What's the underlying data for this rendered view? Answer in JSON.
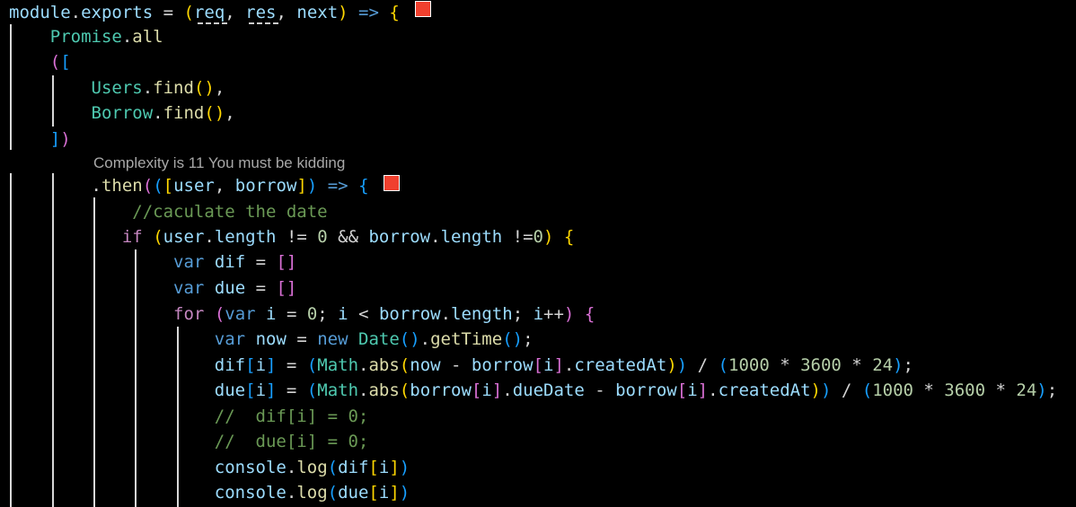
{
  "colors": {
    "background": "#000000",
    "keyword": "#c586c0",
    "function": "#dcdcaa",
    "variable": "#9cdcfe",
    "property": "#9cdcfe",
    "type": "#4ec9b0",
    "number": "#b5cea8",
    "comment": "#6a9955",
    "punctuation": "#d4d4d4",
    "bracket_gold": "#ffd700",
    "bracket_purple": "#da70d6",
    "bracket_blue": "#179fff",
    "codelens": "#a8a8a8",
    "indent_guide": "#d8d8d8",
    "marker": "#f0402e"
  },
  "codelens": "Complexity is 11 You must be kidding",
  "lines": [
    [
      {
        "t": "module",
        "c": "#9cdcfe"
      },
      {
        "t": ".",
        "c": "#d4d4d4"
      },
      {
        "t": "exports",
        "c": "#9cdcfe"
      },
      {
        "t": " = ",
        "c": "#d4d4d4"
      },
      {
        "t": "(",
        "c": "#ffd700"
      },
      {
        "t": "req",
        "c": "#9cdcfe"
      },
      {
        "t": ", ",
        "c": "#d4d4d4"
      },
      {
        "t": "res",
        "c": "#9cdcfe"
      },
      {
        "t": ", ",
        "c": "#d4d4d4"
      },
      {
        "t": "next",
        "c": "#9cdcfe"
      },
      {
        "t": ")",
        "c": "#ffd700"
      },
      {
        "t": " => ",
        "c": "#569cd6"
      },
      {
        "t": "{",
        "c": "#ffd700"
      }
    ],
    [
      {
        "t": "    ",
        "c": "#d4d4d4"
      },
      {
        "t": "Promise",
        "c": "#4ec9b0"
      },
      {
        "t": ".",
        "c": "#d4d4d4"
      },
      {
        "t": "all",
        "c": "#dcdcaa"
      }
    ],
    [
      {
        "t": "    ",
        "c": "#d4d4d4"
      },
      {
        "t": "(",
        "c": "#da70d6"
      },
      {
        "t": "[",
        "c": "#179fff"
      }
    ],
    [
      {
        "t": "        ",
        "c": "#d4d4d4"
      },
      {
        "t": "Users",
        "c": "#4ec9b0"
      },
      {
        "t": ".",
        "c": "#d4d4d4"
      },
      {
        "t": "find",
        "c": "#dcdcaa"
      },
      {
        "t": "()",
        "c": "#ffd700"
      },
      {
        "t": ",",
        "c": "#d4d4d4"
      }
    ],
    [
      {
        "t": "        ",
        "c": "#d4d4d4"
      },
      {
        "t": "Borrow",
        "c": "#4ec9b0"
      },
      {
        "t": ".",
        "c": "#d4d4d4"
      },
      {
        "t": "find",
        "c": "#dcdcaa"
      },
      {
        "t": "()",
        "c": "#ffd700"
      },
      {
        "t": ",",
        "c": "#d4d4d4"
      }
    ],
    [
      {
        "t": "    ",
        "c": "#d4d4d4"
      },
      {
        "t": "]",
        "c": "#179fff"
      },
      {
        "t": ")",
        "c": "#da70d6"
      }
    ],
    [
      {
        "t": "        ",
        "c": "#d4d4d4"
      },
      {
        "t": ".",
        "c": "#d4d4d4"
      },
      {
        "t": "then",
        "c": "#dcdcaa"
      },
      {
        "t": "(",
        "c": "#da70d6"
      },
      {
        "t": "(",
        "c": "#179fff"
      },
      {
        "t": "[",
        "c": "#ffd700"
      },
      {
        "t": "user",
        "c": "#9cdcfe"
      },
      {
        "t": ", ",
        "c": "#d4d4d4"
      },
      {
        "t": "borrow",
        "c": "#9cdcfe"
      },
      {
        "t": "]",
        "c": "#ffd700"
      },
      {
        "t": ")",
        "c": "#179fff"
      },
      {
        "t": " => ",
        "c": "#569cd6"
      },
      {
        "t": "{",
        "c": "#179fff"
      }
    ],
    [
      {
        "t": "            ",
        "c": "#d4d4d4"
      },
      {
        "t": "//caculate the date",
        "c": "#6a9955"
      }
    ],
    [
      {
        "t": "           ",
        "c": "#d4d4d4"
      },
      {
        "t": "if",
        "c": "#c586c0"
      },
      {
        "t": " ",
        "c": "#d4d4d4"
      },
      {
        "t": "(",
        "c": "#ffd700"
      },
      {
        "t": "user",
        "c": "#9cdcfe"
      },
      {
        "t": ".",
        "c": "#d4d4d4"
      },
      {
        "t": "length",
        "c": "#9cdcfe"
      },
      {
        "t": " != ",
        "c": "#d4d4d4"
      },
      {
        "t": "0",
        "c": "#b5cea8"
      },
      {
        "t": " && ",
        "c": "#d4d4d4"
      },
      {
        "t": "borrow",
        "c": "#9cdcfe"
      },
      {
        "t": ".",
        "c": "#d4d4d4"
      },
      {
        "t": "length",
        "c": "#9cdcfe"
      },
      {
        "t": " !=",
        "c": "#d4d4d4"
      },
      {
        "t": "0",
        "c": "#b5cea8"
      },
      {
        "t": ")",
        "c": "#ffd700"
      },
      {
        "t": " ",
        "c": "#d4d4d4"
      },
      {
        "t": "{",
        "c": "#ffd700"
      }
    ],
    [
      {
        "t": "                ",
        "c": "#d4d4d4"
      },
      {
        "t": "var",
        "c": "#569cd6"
      },
      {
        "t": " ",
        "c": "#d4d4d4"
      },
      {
        "t": "dif",
        "c": "#9cdcfe"
      },
      {
        "t": " = ",
        "c": "#d4d4d4"
      },
      {
        "t": "[]",
        "c": "#da70d6"
      }
    ],
    [
      {
        "t": "                ",
        "c": "#d4d4d4"
      },
      {
        "t": "var",
        "c": "#569cd6"
      },
      {
        "t": " ",
        "c": "#d4d4d4"
      },
      {
        "t": "due",
        "c": "#9cdcfe"
      },
      {
        "t": " = ",
        "c": "#d4d4d4"
      },
      {
        "t": "[]",
        "c": "#da70d6"
      }
    ],
    [
      {
        "t": "                ",
        "c": "#d4d4d4"
      },
      {
        "t": "for",
        "c": "#c586c0"
      },
      {
        "t": " ",
        "c": "#d4d4d4"
      },
      {
        "t": "(",
        "c": "#da70d6"
      },
      {
        "t": "var",
        "c": "#569cd6"
      },
      {
        "t": " ",
        "c": "#d4d4d4"
      },
      {
        "t": "i",
        "c": "#9cdcfe"
      },
      {
        "t": " = ",
        "c": "#d4d4d4"
      },
      {
        "t": "0",
        "c": "#b5cea8"
      },
      {
        "t": "; ",
        "c": "#d4d4d4"
      },
      {
        "t": "i",
        "c": "#9cdcfe"
      },
      {
        "t": " < ",
        "c": "#d4d4d4"
      },
      {
        "t": "borrow",
        "c": "#9cdcfe"
      },
      {
        "t": ".",
        "c": "#d4d4d4"
      },
      {
        "t": "length",
        "c": "#9cdcfe"
      },
      {
        "t": "; ",
        "c": "#d4d4d4"
      },
      {
        "t": "i",
        "c": "#9cdcfe"
      },
      {
        "t": "++",
        "c": "#d4d4d4"
      },
      {
        "t": ")",
        "c": "#da70d6"
      },
      {
        "t": " ",
        "c": "#d4d4d4"
      },
      {
        "t": "{",
        "c": "#da70d6"
      }
    ],
    [
      {
        "t": "                    ",
        "c": "#d4d4d4"
      },
      {
        "t": "var",
        "c": "#569cd6"
      },
      {
        "t": " ",
        "c": "#d4d4d4"
      },
      {
        "t": "now",
        "c": "#9cdcfe"
      },
      {
        "t": " = ",
        "c": "#d4d4d4"
      },
      {
        "t": "new",
        "c": "#569cd6"
      },
      {
        "t": " ",
        "c": "#d4d4d4"
      },
      {
        "t": "Date",
        "c": "#4ec9b0"
      },
      {
        "t": "()",
        "c": "#179fff"
      },
      {
        "t": ".",
        "c": "#d4d4d4"
      },
      {
        "t": "getTime",
        "c": "#dcdcaa"
      },
      {
        "t": "()",
        "c": "#179fff"
      },
      {
        "t": ";",
        "c": "#d4d4d4"
      }
    ],
    [
      {
        "t": "                    ",
        "c": "#d4d4d4"
      },
      {
        "t": "dif",
        "c": "#9cdcfe"
      },
      {
        "t": "[",
        "c": "#179fff"
      },
      {
        "t": "i",
        "c": "#9cdcfe"
      },
      {
        "t": "]",
        "c": "#179fff"
      },
      {
        "t": " = ",
        "c": "#d4d4d4"
      },
      {
        "t": "(",
        "c": "#179fff"
      },
      {
        "t": "Math",
        "c": "#4ec9b0"
      },
      {
        "t": ".",
        "c": "#d4d4d4"
      },
      {
        "t": "abs",
        "c": "#dcdcaa"
      },
      {
        "t": "(",
        "c": "#ffd700"
      },
      {
        "t": "now",
        "c": "#9cdcfe"
      },
      {
        "t": " - ",
        "c": "#d4d4d4"
      },
      {
        "t": "borrow",
        "c": "#9cdcfe"
      },
      {
        "t": "[",
        "c": "#da70d6"
      },
      {
        "t": "i",
        "c": "#9cdcfe"
      },
      {
        "t": "]",
        "c": "#da70d6"
      },
      {
        "t": ".",
        "c": "#d4d4d4"
      },
      {
        "t": "createdAt",
        "c": "#9cdcfe"
      },
      {
        "t": ")",
        "c": "#ffd700"
      },
      {
        "t": ")",
        "c": "#179fff"
      },
      {
        "t": " / ",
        "c": "#d4d4d4"
      },
      {
        "t": "(",
        "c": "#179fff"
      },
      {
        "t": "1000",
        "c": "#b5cea8"
      },
      {
        "t": " * ",
        "c": "#d4d4d4"
      },
      {
        "t": "3600",
        "c": "#b5cea8"
      },
      {
        "t": " * ",
        "c": "#d4d4d4"
      },
      {
        "t": "24",
        "c": "#b5cea8"
      },
      {
        "t": ")",
        "c": "#179fff"
      },
      {
        "t": ";",
        "c": "#d4d4d4"
      }
    ],
    [
      {
        "t": "                    ",
        "c": "#d4d4d4"
      },
      {
        "t": "due",
        "c": "#9cdcfe"
      },
      {
        "t": "[",
        "c": "#179fff"
      },
      {
        "t": "i",
        "c": "#9cdcfe"
      },
      {
        "t": "]",
        "c": "#179fff"
      },
      {
        "t": " = ",
        "c": "#d4d4d4"
      },
      {
        "t": "(",
        "c": "#179fff"
      },
      {
        "t": "Math",
        "c": "#4ec9b0"
      },
      {
        "t": ".",
        "c": "#d4d4d4"
      },
      {
        "t": "abs",
        "c": "#dcdcaa"
      },
      {
        "t": "(",
        "c": "#ffd700"
      },
      {
        "t": "borrow",
        "c": "#9cdcfe"
      },
      {
        "t": "[",
        "c": "#da70d6"
      },
      {
        "t": "i",
        "c": "#9cdcfe"
      },
      {
        "t": "]",
        "c": "#da70d6"
      },
      {
        "t": ".",
        "c": "#d4d4d4"
      },
      {
        "t": "dueDate",
        "c": "#9cdcfe"
      },
      {
        "t": " - ",
        "c": "#d4d4d4"
      },
      {
        "t": "borrow",
        "c": "#9cdcfe"
      },
      {
        "t": "[",
        "c": "#da70d6"
      },
      {
        "t": "i",
        "c": "#9cdcfe"
      },
      {
        "t": "]",
        "c": "#da70d6"
      },
      {
        "t": ".",
        "c": "#d4d4d4"
      },
      {
        "t": "createdAt",
        "c": "#9cdcfe"
      },
      {
        "t": ")",
        "c": "#ffd700"
      },
      {
        "t": ")",
        "c": "#179fff"
      },
      {
        "t": " / ",
        "c": "#d4d4d4"
      },
      {
        "t": "(",
        "c": "#179fff"
      },
      {
        "t": "1000",
        "c": "#b5cea8"
      },
      {
        "t": " * ",
        "c": "#d4d4d4"
      },
      {
        "t": "3600",
        "c": "#b5cea8"
      },
      {
        "t": " * ",
        "c": "#d4d4d4"
      },
      {
        "t": "24",
        "c": "#b5cea8"
      },
      {
        "t": ")",
        "c": "#179fff"
      },
      {
        "t": ";",
        "c": "#d4d4d4"
      }
    ],
    [
      {
        "t": "                    ",
        "c": "#d4d4d4"
      },
      {
        "t": "//  dif[i] = 0;",
        "c": "#6a9955"
      }
    ],
    [
      {
        "t": "                    ",
        "c": "#d4d4d4"
      },
      {
        "t": "//  due[i] = 0;",
        "c": "#6a9955"
      }
    ],
    [
      {
        "t": "                    ",
        "c": "#d4d4d4"
      },
      {
        "t": "console",
        "c": "#9cdcfe"
      },
      {
        "t": ".",
        "c": "#d4d4d4"
      },
      {
        "t": "log",
        "c": "#dcdcaa"
      },
      {
        "t": "(",
        "c": "#179fff"
      },
      {
        "t": "dif",
        "c": "#9cdcfe"
      },
      {
        "t": "[",
        "c": "#ffd700"
      },
      {
        "t": "i",
        "c": "#9cdcfe"
      },
      {
        "t": "]",
        "c": "#ffd700"
      },
      {
        "t": ")",
        "c": "#179fff"
      }
    ],
    [
      {
        "t": "                    ",
        "c": "#d4d4d4"
      },
      {
        "t": "console",
        "c": "#9cdcfe"
      },
      {
        "t": ".",
        "c": "#d4d4d4"
      },
      {
        "t": "log",
        "c": "#dcdcaa"
      },
      {
        "t": "(",
        "c": "#179fff"
      },
      {
        "t": "due",
        "c": "#9cdcfe"
      },
      {
        "t": "[",
        "c": "#ffd700"
      },
      {
        "t": "i",
        "c": "#9cdcfe"
      },
      {
        "t": "]",
        "c": "#ffd700"
      },
      {
        "t": ")",
        "c": "#179fff"
      }
    ]
  ]
}
